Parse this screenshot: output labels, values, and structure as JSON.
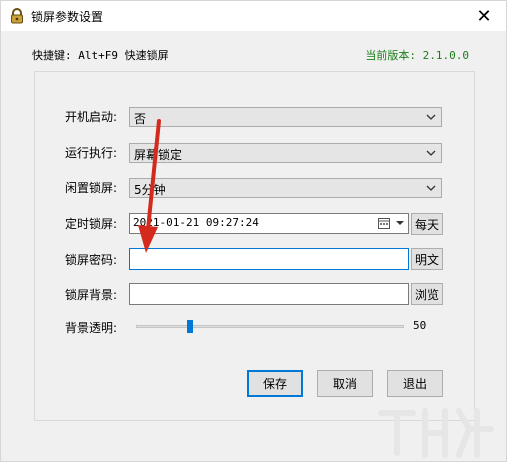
{
  "window": {
    "title": "锁屏参数设置",
    "close_glyph": "✕"
  },
  "header": {
    "hotkey": "快捷键: Alt+F9 快速锁屏",
    "version": "当前版本: 2.1.0.0"
  },
  "form": {
    "startup": {
      "label": "开机启动:",
      "value": "否"
    },
    "run_action": {
      "label": "运行执行:",
      "value": "屏幕锁定"
    },
    "idle_lock": {
      "label": "闲置锁屏:",
      "value": "5分钟"
    },
    "timed_lock": {
      "label": "定时锁屏:",
      "value": "2021-01-21 09:27:24",
      "button": "每天"
    },
    "password": {
      "label": "锁屏密码:",
      "value": "",
      "button": "明文"
    },
    "background": {
      "label": "锁屏背景:",
      "value": "",
      "button": "浏览"
    },
    "opacity": {
      "label": "背景透明:",
      "value": "50",
      "level": 50,
      "max": 255
    }
  },
  "buttons": {
    "save": "保存",
    "cancel": "取消",
    "exit": "退出"
  },
  "colors": {
    "accent": "#0078d7",
    "version_text": "#1a7d1a",
    "annotation_arrow": "#d42a1e"
  },
  "icons": {
    "app": "lock-icon",
    "calendar": "calendar-icon",
    "dropdown": "chevron-down-icon"
  }
}
